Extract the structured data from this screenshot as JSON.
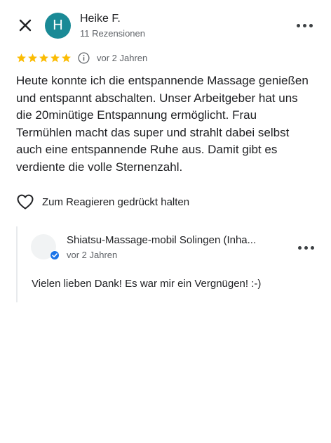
{
  "reviewer": {
    "initial": "H",
    "name": "Heike F.",
    "meta": "11 Rezensionen",
    "avatar_color": "#1a8a96"
  },
  "review": {
    "rating": 5,
    "max_rating": 5,
    "star_color": "#fbbc04",
    "date": "vor 2 Jahren",
    "text": "Heute konnte ich die entspannende Massage genießen und entspannt abschalten. Unser Arbeitgeber hat uns die 20minütige Entspannung ermöglicht. Frau Termühlen macht das super und strahlt dabei selbst auch eine entspannende Ruhe aus. Damit gibt es verdiente die volle Sternenzahl."
  },
  "actions": {
    "react_label": "Zum Reagieren gedrückt halten"
  },
  "owner_reply": {
    "name": "Shiatsu-Massage-mobil Solingen (Inha...",
    "date": "vor 2 Jahren",
    "text": "Vielen lieben Dank! Es war mir ein Vergnügen! :-)",
    "badge_color": "#1a73e8"
  },
  "icons": {
    "close": "close-icon",
    "more": "more-horizontal-icon",
    "star": "star-icon",
    "info": "info-icon",
    "heart": "heart-outline-icon",
    "verified": "verified-badge-icon"
  }
}
